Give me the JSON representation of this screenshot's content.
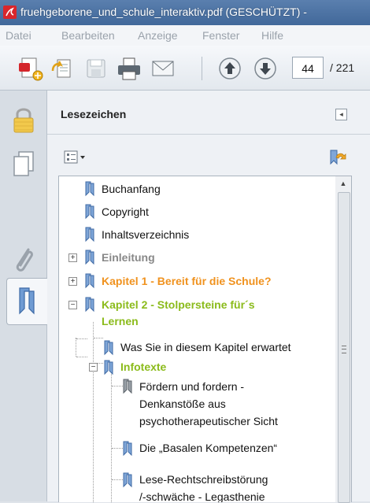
{
  "window": {
    "title": "fruehgeborene_und_schule_interaktiv.pdf (GESCHÜTZT) -"
  },
  "menu": [
    "Datei",
    "Bearbeiten",
    "Anzeige",
    "Fenster",
    "Hilfe"
  ],
  "toolbar": {
    "page_current": "44",
    "page_total": "/ 221"
  },
  "panel": {
    "title": "Lesezeichen"
  },
  "bookmarks": [
    {
      "label": "Buchanfang"
    },
    {
      "label": "Copyright"
    },
    {
      "label": "Inhaltsverzeichnis"
    },
    {
      "label": "Einleitung"
    },
    {
      "label": "Kapitel 1 - Bereit für die Schule?"
    },
    {
      "label_line1": "Kapitel 2 - Stolpersteine für´s",
      "label_line2": "Lernen"
    },
    {
      "label": "Was Sie in diesem Kapitel erwartet"
    },
    {
      "label": "Infotexte"
    },
    {
      "label_line1": "Fördern und fordern -",
      "label_line2": "Denkanstöße aus",
      "label_line3": "psychotherapeutischer Sicht"
    },
    {
      "label": "Die „Basalen Kompetenzen“"
    },
    {
      "label_line1": "Lese-Rechtschreibstörung",
      "label_line2": "/-schwäche - Legasthenie"
    }
  ],
  "colors": {
    "orange": "#f0921e",
    "green": "#8bbb1b",
    "grey": "#888888",
    "bookmark_blue": "#4f7bb4"
  }
}
